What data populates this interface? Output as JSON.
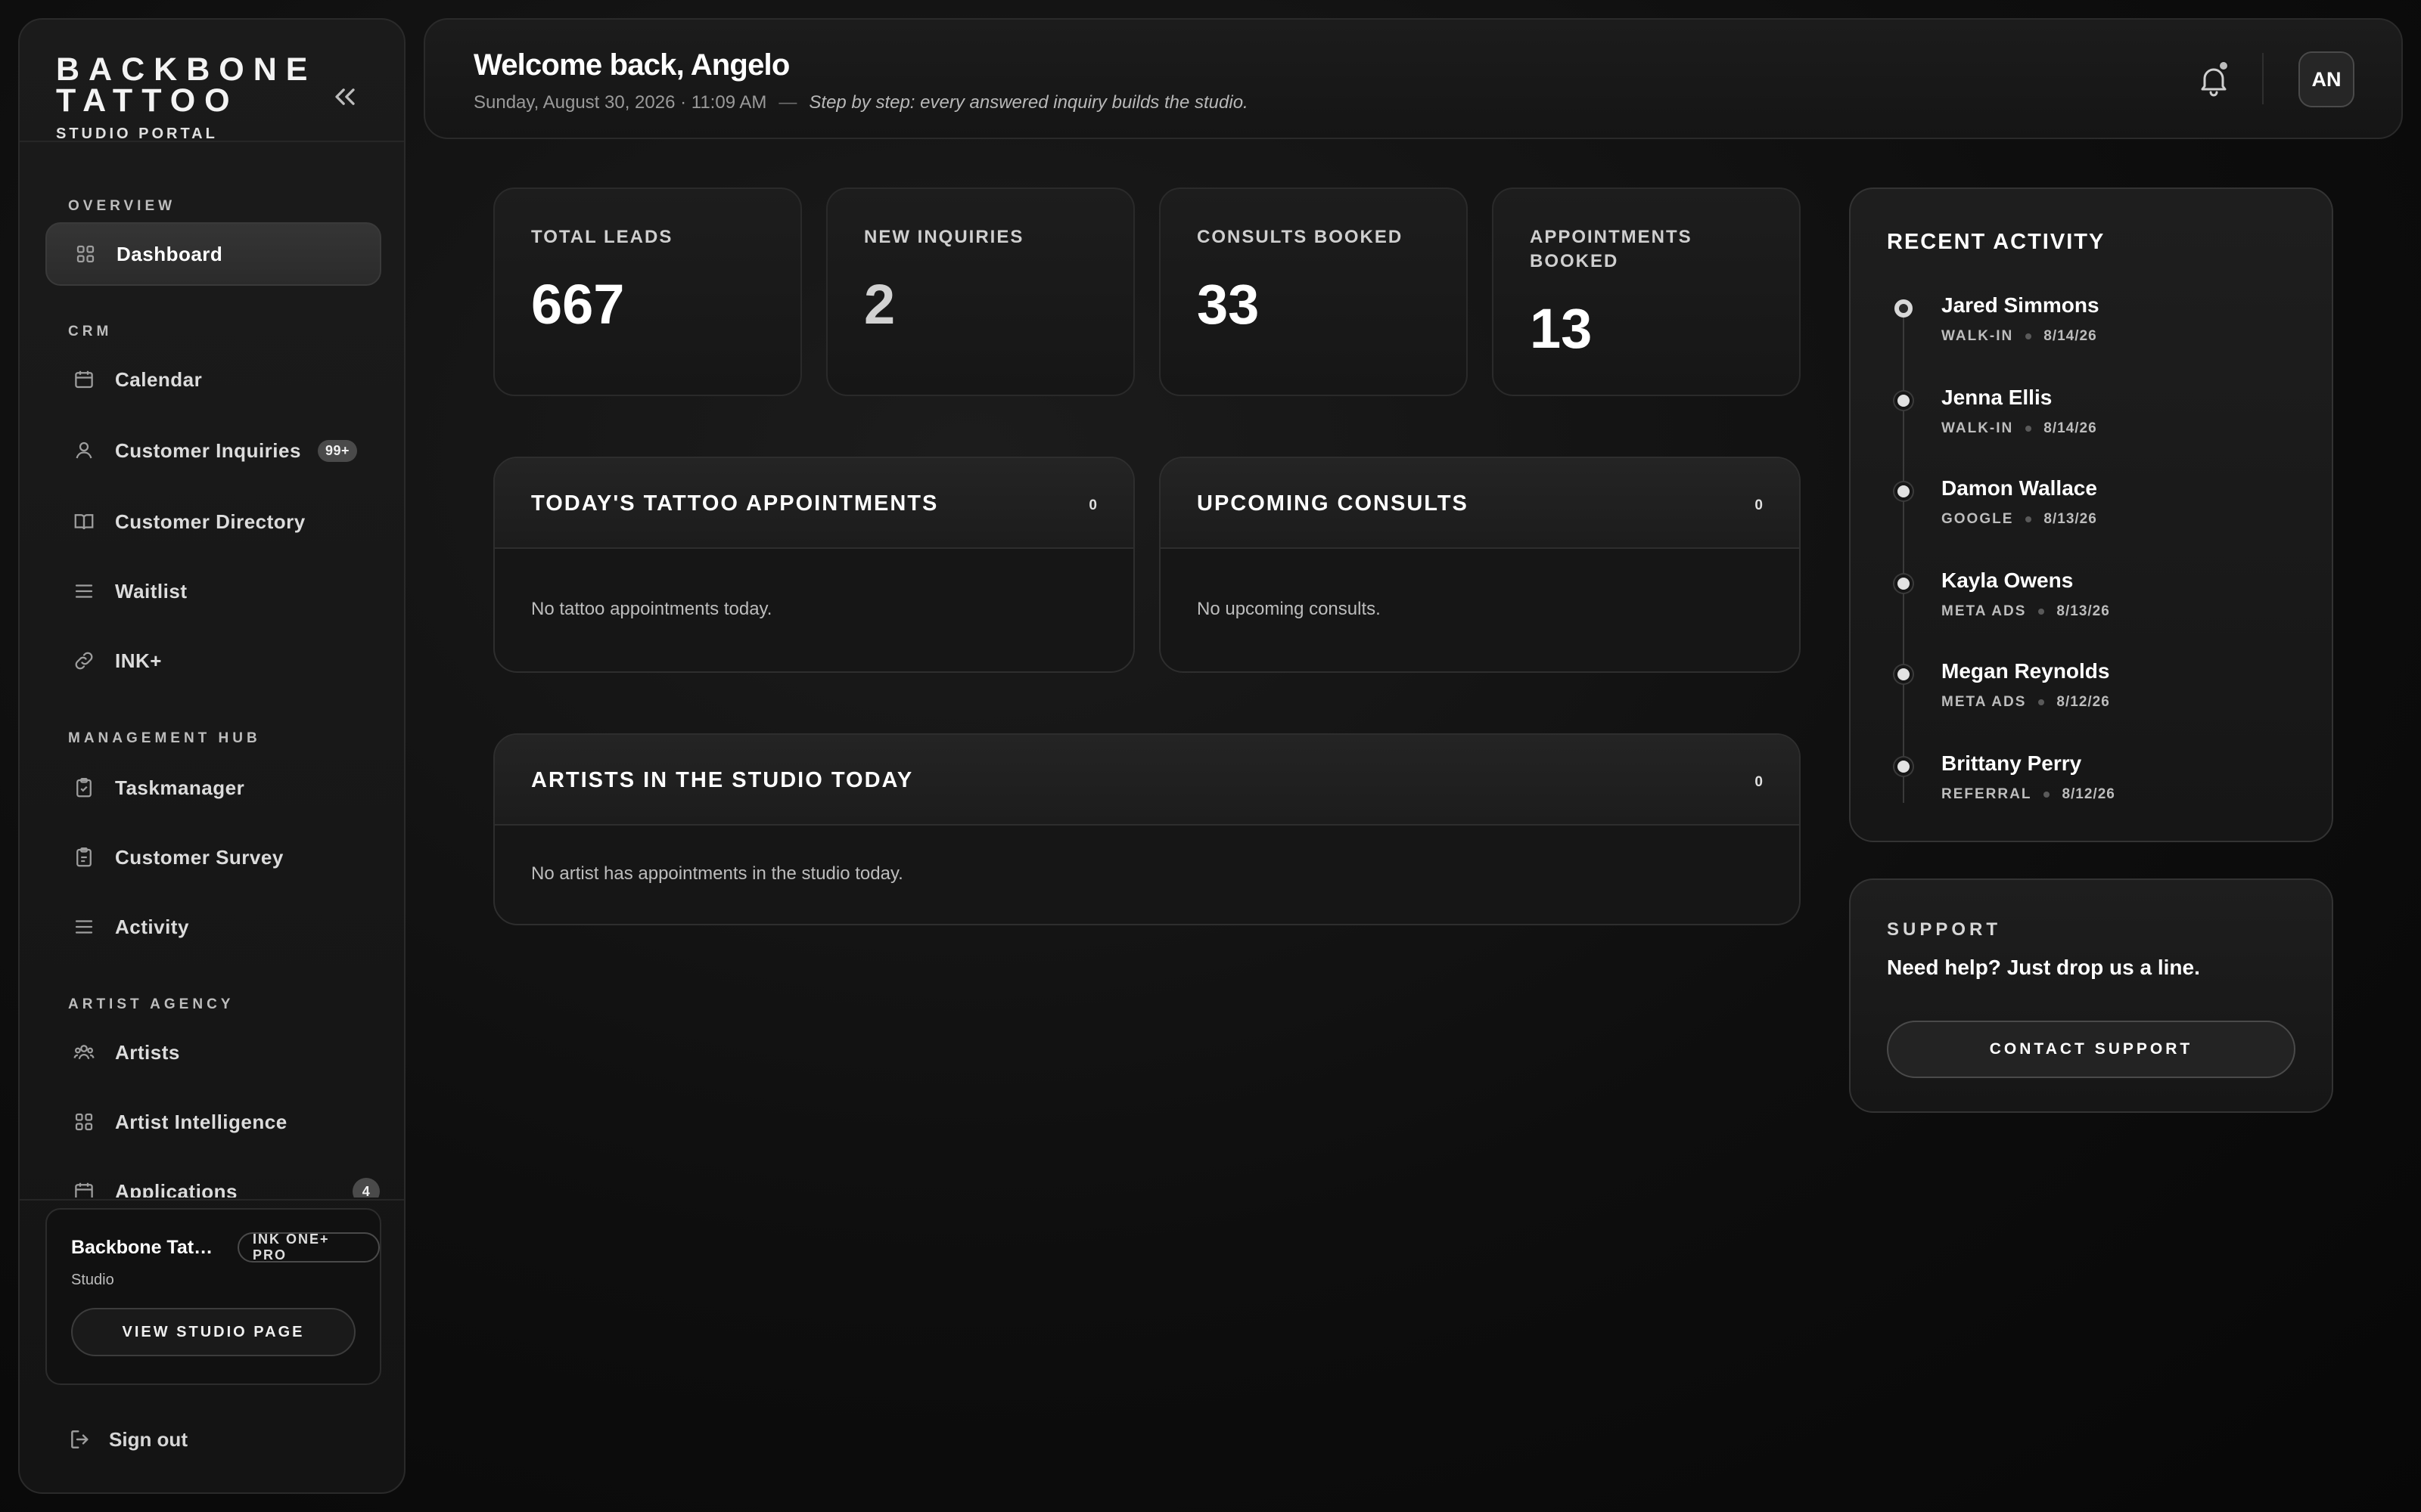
{
  "brand": {
    "title": "BACKBONE TATTOO",
    "subtitle": "STUDIO PORTAL"
  },
  "sidebar": {
    "sections": {
      "overview": "OVERVIEW",
      "crm": "CRM",
      "management": "MANAGEMENT HUB",
      "artist_agency": "ARTIST AGENCY"
    },
    "items": {
      "dashboard": "Dashboard",
      "calendar": "Calendar",
      "inquiries": "Customer Inquiries",
      "inquiries_badge": "99+",
      "directory": "Customer Directory",
      "waitlist": "Waitlist",
      "ink": "INK+",
      "taskmanager": "Taskmanager",
      "survey": "Customer Survey",
      "activity": "Activity",
      "artists": "Artists",
      "intelligence": "Artist Intelligence",
      "applications": "Applications",
      "applications_badge": "4"
    },
    "studio": {
      "name": "Backbone Tattoo",
      "plan": "INK ONE+ PRO",
      "type": "Studio",
      "button": "VIEW STUDIO PAGE"
    },
    "signout": "Sign out"
  },
  "header": {
    "welcome": "Welcome back, Angelo",
    "datetime": "Sunday, August 30, 2026 · 11:09 AM",
    "dash": "—",
    "motto": "Step by step: every answered inquiry builds the studio.",
    "avatar": "AN"
  },
  "stats": [
    {
      "label": "TOTAL LEADS",
      "value": "667"
    },
    {
      "label": "NEW INQUIRIES",
      "value": "2"
    },
    {
      "label": "CONSULTS BOOKED",
      "value": "33"
    },
    {
      "label": "APPOINTMENTS BOOKED",
      "value": "13"
    }
  ],
  "panels": {
    "appointments": {
      "title": "TODAY'S TATTOO APPOINTMENTS",
      "count": "0",
      "empty": "No tattoo appointments today."
    },
    "consults": {
      "title": "UPCOMING CONSULTS",
      "count": "0",
      "empty": "No upcoming consults."
    },
    "artists": {
      "title": "ARTISTS IN THE STUDIO TODAY",
      "count": "0",
      "empty": "No artist has appointments in the studio today."
    }
  },
  "activity": {
    "title": "RECENT ACTIVITY",
    "items": [
      {
        "name": "Jared Simmons",
        "source": "WALK-IN",
        "date": "8/14/26"
      },
      {
        "name": "Jenna Ellis",
        "source": "WALK-IN",
        "date": "8/14/26"
      },
      {
        "name": "Damon Wallace",
        "source": "GOOGLE",
        "date": "8/13/26"
      },
      {
        "name": "Kayla Owens",
        "source": "META ADS",
        "date": "8/13/26"
      },
      {
        "name": "Megan Reynolds",
        "source": "META ADS",
        "date": "8/12/26"
      },
      {
        "name": "Brittany Perry",
        "source": "REFERRAL",
        "date": "8/12/26"
      }
    ]
  },
  "support": {
    "label": "SUPPORT",
    "text": "Need help? Just drop us a line.",
    "button": "CONTACT SUPPORT"
  }
}
